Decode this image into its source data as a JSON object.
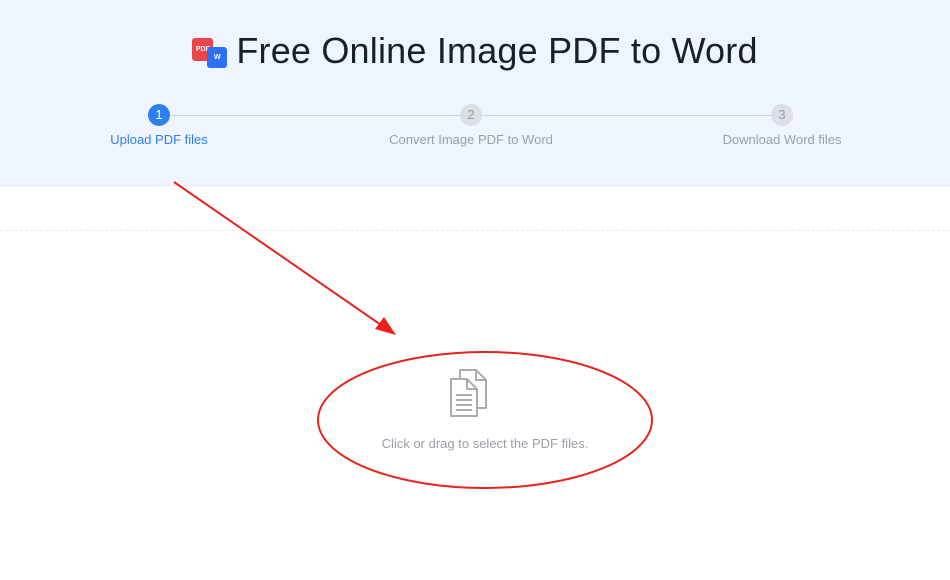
{
  "header": {
    "title": "Free Online Image PDF to Word",
    "logo": {
      "badge_pdf": "PDF",
      "badge_word": "W",
      "colors": {
        "pdf": "#e9454a",
        "word": "#2f6ff1"
      }
    },
    "background_color": "#eef5fe"
  },
  "stepper": {
    "active_step": 1,
    "steps": [
      {
        "number": "1",
        "label": "Upload PDF files"
      },
      {
        "number": "2",
        "label": "Convert Image PDF to Word"
      },
      {
        "number": "3",
        "label": "Download Word files"
      }
    ],
    "colors": {
      "active": "#2f7ff0",
      "inactive": "#9aa0a8"
    }
  },
  "upload": {
    "icon": "documents-icon",
    "hint": "Click or drag to select the PDF files."
  },
  "annotation": {
    "arrow_color": "#e8231d",
    "ellipse_color": "#e8231d"
  }
}
